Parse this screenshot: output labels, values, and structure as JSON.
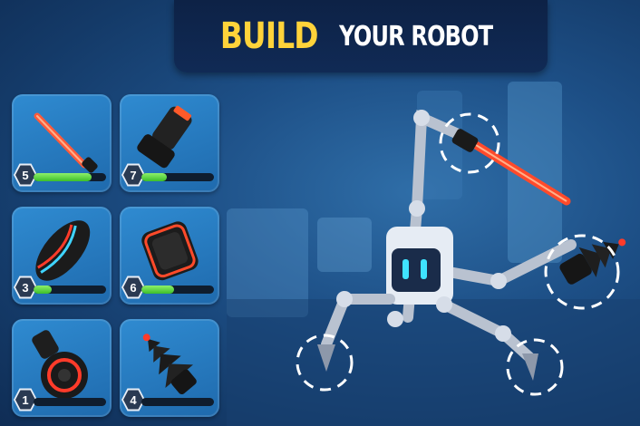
{
  "title": {
    "highlight": "BUILD",
    "rest": "YOUR ROBOT"
  },
  "parts": [
    {
      "name": "laser-sword",
      "level": "5",
      "progress": 0.8
    },
    {
      "name": "cannon",
      "level": "7",
      "progress": 0.35
    },
    {
      "name": "plasma-blade",
      "level": "3",
      "progress": 0.25
    },
    {
      "name": "armor-block",
      "level": "6",
      "progress": 0.45
    },
    {
      "name": "wheel-blaster",
      "level": "1",
      "progress": 0.0
    },
    {
      "name": "drill",
      "level": "4",
      "progress": 0.0
    }
  ],
  "colors": {
    "accent": "#ffd33a",
    "progress": "#5fd63e",
    "laser": "#ff3b2a",
    "eyes": "#3fe4ff"
  }
}
